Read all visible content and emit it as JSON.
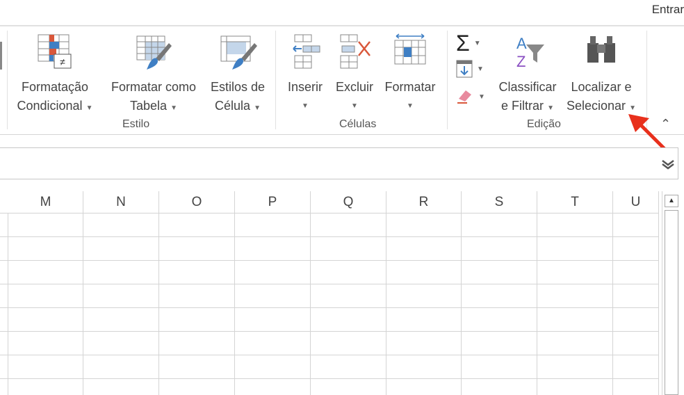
{
  "header": {
    "account_text": "Entrar"
  },
  "ribbon": {
    "estilo": {
      "group_label": "Estilo",
      "buttons": [
        {
          "line1": "Formatação",
          "line2": "Condicional",
          "icon": "conditional-formatting-icon"
        },
        {
          "line1": "Formatar como",
          "line2": "Tabela",
          "icon": "format-as-table-icon"
        },
        {
          "line1": "Estilos de",
          "line2": "Célula",
          "icon": "cell-styles-icon"
        }
      ]
    },
    "celulas": {
      "group_label": "Células",
      "buttons": [
        {
          "line1": "Inserir",
          "icon": "insert-cells-icon"
        },
        {
          "line1": "Excluir",
          "icon": "delete-cells-icon"
        },
        {
          "line1": "Formatar",
          "icon": "format-cells-icon"
        }
      ]
    },
    "edicao": {
      "group_label": "Edição",
      "small_buttons": [
        "autosum-icon",
        "fill-icon",
        "clear-icon"
      ],
      "buttons": [
        {
          "line1": "Classificar",
          "line2": "e Filtrar",
          "icon": "sort-filter-icon"
        },
        {
          "line1": "Localizar e",
          "line2": "Selecionar",
          "icon": "find-select-icon"
        }
      ]
    }
  },
  "sheet": {
    "columns": [
      "M",
      "N",
      "O",
      "P",
      "Q",
      "R",
      "S",
      "T",
      "U"
    ]
  },
  "colors": {
    "arrow": "#e8301c",
    "accent_blue": "#3f7fc4",
    "accent_red": "#d9573a"
  }
}
